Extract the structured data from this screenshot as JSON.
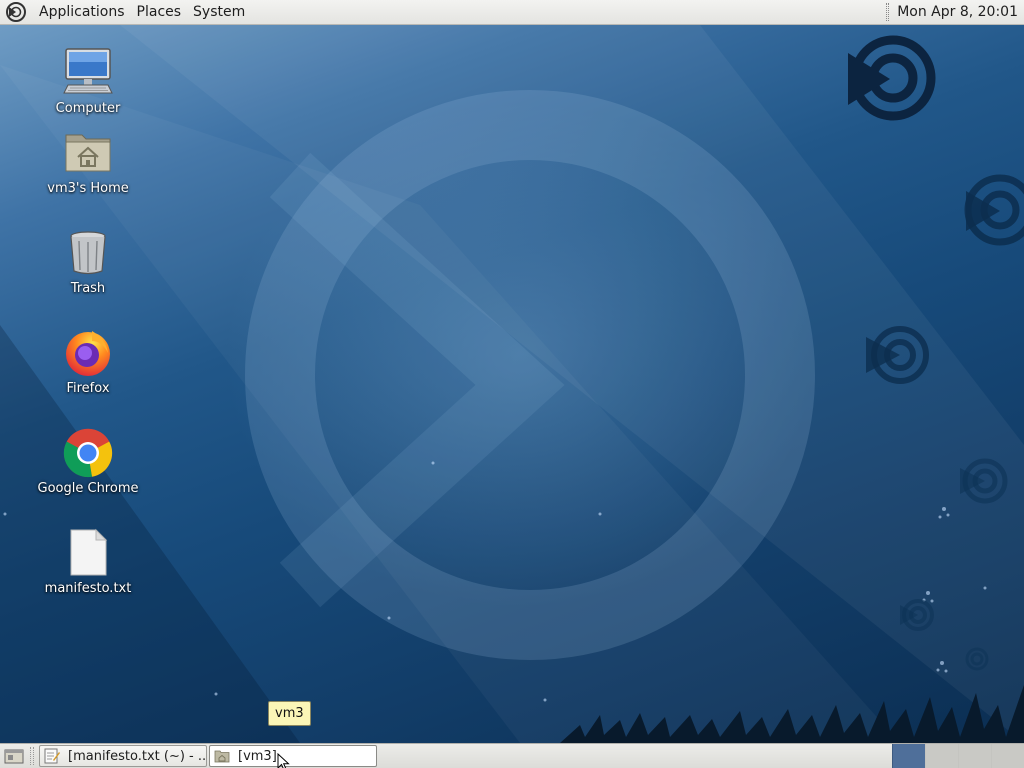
{
  "top_panel": {
    "menus": [
      "Applications",
      "Places",
      "System"
    ],
    "clock": "Mon Apr  8, 20:01",
    "logo_icon": "mate-logo-icon"
  },
  "desktop_icons": [
    {
      "label": "Computer",
      "icon": "computer-icon"
    },
    {
      "label": "vm3's Home",
      "icon": "home-folder-icon"
    },
    {
      "label": "Trash",
      "icon": "trash-icon"
    },
    {
      "label": "Firefox",
      "icon": "firefox-icon"
    },
    {
      "label": "Google Chrome",
      "icon": "chrome-icon"
    },
    {
      "label": "manifesto.txt",
      "icon": "text-file-icon"
    }
  ],
  "tooltip": "vm3",
  "taskbar": {
    "tasks": [
      {
        "label": "[manifesto.txt (~) - ...",
        "icon": "text-editor-icon"
      },
      {
        "label": "[vm3]",
        "icon": "folder-icon"
      }
    ],
    "workspaces": {
      "count": 4,
      "current": 1
    }
  },
  "colors": {
    "accent": "#4f6f9a",
    "tooltip_bg": "#fbf6b7"
  }
}
